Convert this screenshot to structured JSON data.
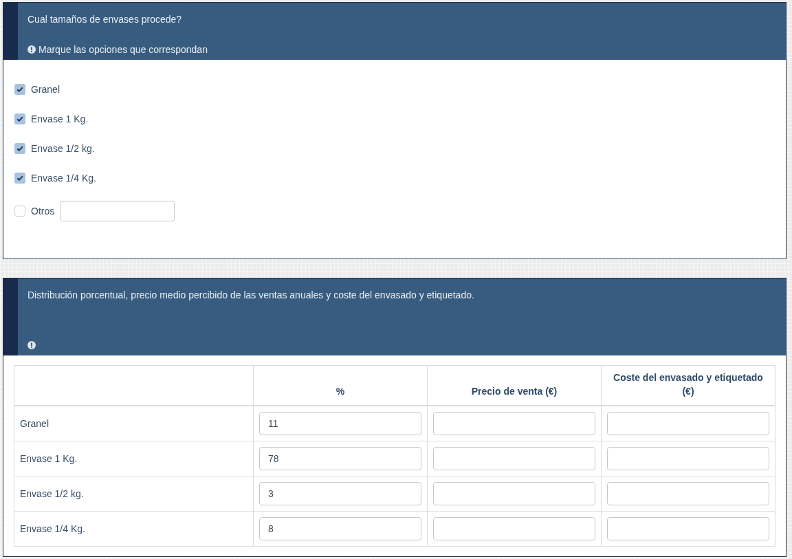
{
  "panels": [
    {
      "kind": "checklist",
      "title": "Cual tamaños de envases procede?",
      "hint": "Marque las opciones que correspondan",
      "options": [
        {
          "kind": "option",
          "label": "Granel",
          "checked": true
        },
        {
          "kind": "option",
          "label": "Envase 1 Kg.",
          "checked": true
        },
        {
          "kind": "option",
          "label": "Envase 1/2 kg.",
          "checked": true
        },
        {
          "kind": "option",
          "label": "Envase 1/4 Kg.",
          "checked": true
        },
        {
          "kind": "other",
          "label": "Otros",
          "checked": false
        }
      ]
    },
    {
      "kind": "table",
      "title": "Distribución porcentual, precio medio percibido de las ventas anuales y coste del envasado y etiquetado.",
      "table": {
        "columns": [
          "%",
          "Precio de venta (€)",
          "Coste del envasado y etiquetado (€)"
        ],
        "rows": [
          {
            "label": "Granel",
            "values": [
              "11"
            ]
          },
          {
            "label": "Envase 1 Kg.",
            "values": [
              "78"
            ]
          },
          {
            "label": "Envase 1/2 kg.",
            "values": [
              "3"
            ]
          },
          {
            "label": "Envase 1/4 Kg.",
            "values": [
              "8"
            ]
          }
        ]
      }
    }
  ]
}
